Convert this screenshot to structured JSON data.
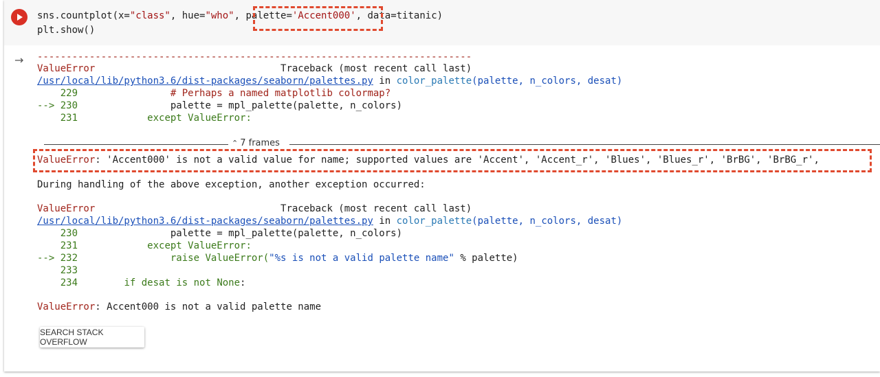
{
  "code": {
    "line1_a": "sns.countplot(x=",
    "line1_str1": "\"class\"",
    "line1_b": ", hue=",
    "line1_str2": "\"who\"",
    "line1_c": ", ",
    "line1_palette_key": "palette=",
    "line1_palette_val": "'Accent000'",
    "line1_d": ", data=titanic)",
    "line2": "plt.show()"
  },
  "traceback1": {
    "dashes": "---------------------------------------------------------------------------",
    "error_name": "ValueError",
    "traceback_label": "Traceback (most recent call last)",
    "file_link": "/usr/local/lib/python3.6/dist-packages/seaborn/palettes.py",
    "in_word": " in ",
    "func": "color_palette",
    "func_args": "(palette, n_colors, desat)",
    "lines": [
      {
        "num": "    229",
        "code": "                # Perhaps a named matplotlib colormap?"
      },
      {
        "num": "--> 230",
        "code": "                palette = mpl_palette(palette, n_colors)"
      },
      {
        "num": "    231",
        "code": "            except ValueError:"
      }
    ]
  },
  "frames_label": "7 frames",
  "error_message": {
    "name": "ValueError",
    "text": ": 'Accent000' is not a valid value for name; supported values are 'Accent', 'Accent_r', 'Blues', 'Blues_r', 'BrBG', 'BrBG_r',"
  },
  "during_handling": "During handling of the above exception, another exception occurred:",
  "traceback2": {
    "error_name": "ValueError",
    "traceback_label": "Traceback (most recent call last)",
    "file_link": "/usr/local/lib/python3.6/dist-packages/seaborn/palettes.py",
    "in_word": " in ",
    "func": "color_palette",
    "func_args": "(palette, n_colors, desat)",
    "lines": [
      {
        "num": "    230",
        "code": "                palette = mpl_palette(palette, n_colors)"
      },
      {
        "num": "    231",
        "code": "            except ValueError:"
      },
      {
        "num": "--> 232",
        "code_a": "                raise ValueError(",
        "code_str": "\"%s is not a valid palette name\"",
        "code_b": " % palette)"
      },
      {
        "num": "    233",
        "code": ""
      },
      {
        "num": "    234",
        "code_a": "        if desat ",
        "code_kw": "is not None",
        "code_b": ":"
      }
    ]
  },
  "final_error": {
    "name": "ValueError",
    "text": ": Accent000 is not a valid palette name"
  },
  "search_button_label": "SEARCH STACK OVERFLOW",
  "colors": {
    "accent_red": "#d93025",
    "highlight_dash": "#e04a2f",
    "error_text": "#a0241b"
  }
}
